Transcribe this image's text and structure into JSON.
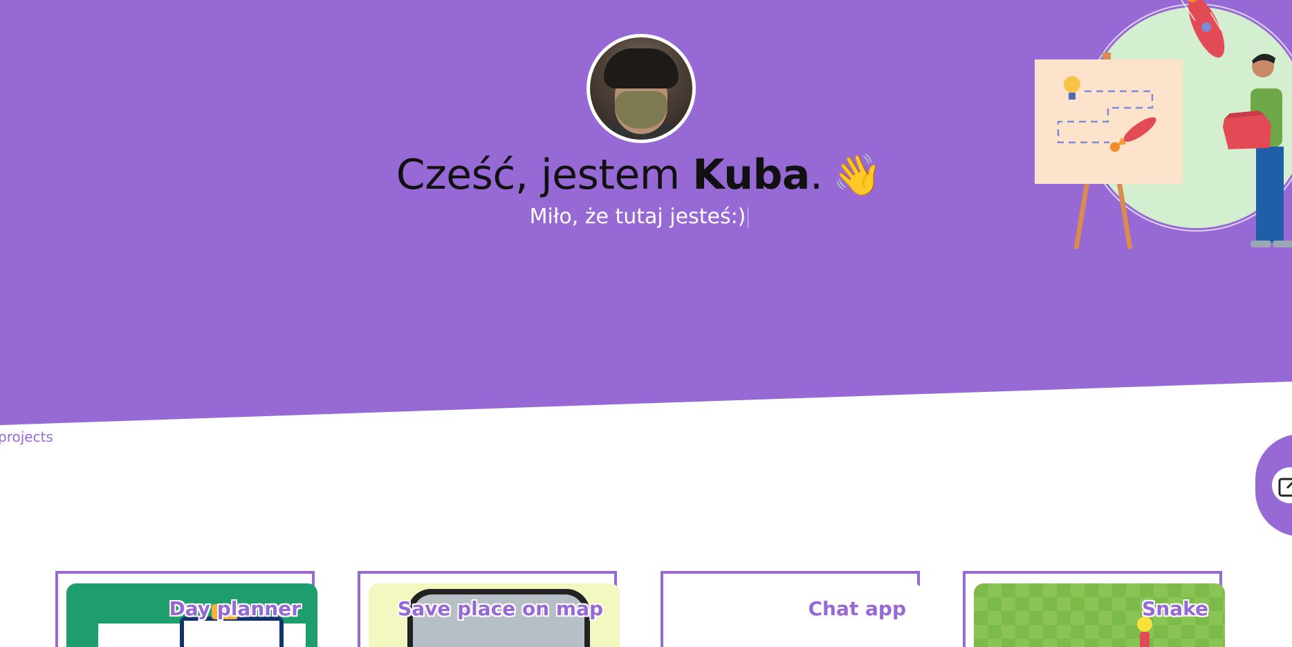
{
  "hero": {
    "greeting_prefix": "Cześć, jestem ",
    "name": "Kuba",
    "greeting_suffix": ".",
    "wave_emoji": "👋",
    "subtitle": "Miło, że tutaj jesteś:)"
  },
  "nav": {
    "projects_link": "projects"
  },
  "fab": {
    "icon": "external-link-icon"
  },
  "colors": {
    "accent": "#9769d5",
    "card_green": "#1e9e6c",
    "card_yellow": "#f3f8c0",
    "card_snake": "#7cba4a"
  },
  "projects": [
    {
      "title": "Day planner"
    },
    {
      "title": "Save place on map"
    },
    {
      "title": "Chat app"
    },
    {
      "title": "Snake"
    }
  ]
}
